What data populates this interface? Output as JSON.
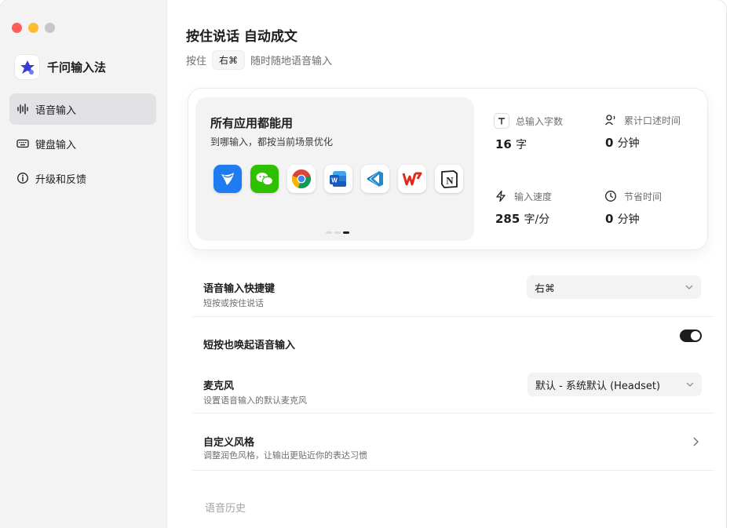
{
  "app": {
    "name": "千问输入法",
    "colors": {
      "accent": "#3b3bd6",
      "close": "#fe5f57",
      "minimize": "#febc2e",
      "zoom": "#c7c7c9"
    }
  },
  "sidebar": {
    "items": [
      {
        "label": "语音输入",
        "icon": "waveform-icon",
        "active": true
      },
      {
        "label": "键盘输入",
        "icon": "keyboard-icon",
        "active": false
      },
      {
        "label": "升级和反馈",
        "icon": "info-icon",
        "active": false
      }
    ]
  },
  "header": {
    "title": "按住说话 自动成文",
    "subtitle_prefix": "按住",
    "subtitle_key": "右⌘",
    "subtitle_suffix": "随时随地语音输入"
  },
  "promo": {
    "title": "所有应用都能用",
    "subtitle": "到哪输入，都按当前场景优化",
    "apps": [
      "feishu-icon",
      "wechat-icon",
      "chrome-icon",
      "word-icon",
      "vscode-icon",
      "wps-icon",
      "notion-icon"
    ],
    "page_count": 3,
    "current_page": 3
  },
  "stats": [
    {
      "label": "总输入字数",
      "value": "16",
      "unit": "字",
      "icon": "text-icon"
    },
    {
      "label": "累计口述时间",
      "value": "0",
      "unit": "分钟",
      "icon": "speaker-icon"
    },
    {
      "label": "输入速度",
      "value": "285",
      "unit": "字/分",
      "icon": "lightning-icon"
    },
    {
      "label": "节省时间",
      "value": "0",
      "unit": "分钟",
      "icon": "clock-icon"
    }
  ],
  "settings": {
    "shortcut": {
      "title": "语音输入快捷键",
      "desc": "短按或按住说话",
      "value": "右⌘"
    },
    "short_press": {
      "title": "短按也唤起语音输入",
      "enabled": true
    },
    "microphone": {
      "title": "麦克风",
      "desc": "设置语音输入的默认麦克风",
      "value": "默认 - 系统默认 (Headset)"
    },
    "style": {
      "title": "自定义风格",
      "desc": "调整润色风格，让输出更贴近你的表达习惯"
    }
  },
  "history": {
    "label": "语音历史"
  }
}
